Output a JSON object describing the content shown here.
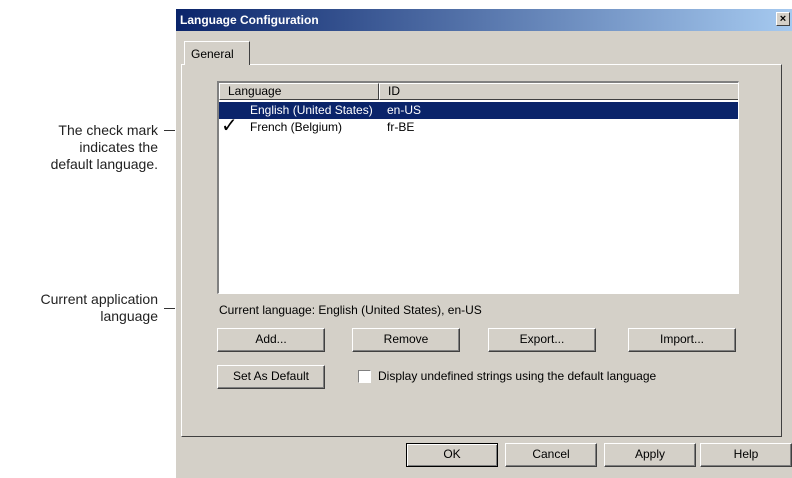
{
  "annotations": {
    "check_mark_note": [
      "The check mark",
      "indicates the",
      "default language."
    ],
    "current_lang_note": [
      "Current application",
      "language"
    ]
  },
  "dialog": {
    "title": "Language Configuration",
    "close_label": "×",
    "tab_label": "General",
    "list": {
      "columns": [
        "Language",
        "ID"
      ],
      "rows": [
        {
          "language": "English (United States)",
          "id": "en-US",
          "selected": true,
          "default": false
        },
        {
          "language": "French (Belgium)",
          "id": "fr-BE",
          "selected": false,
          "default": true
        }
      ],
      "check_glyph": "✓"
    },
    "current_language": "Current language: English (United States), en-US",
    "buttons": {
      "add": "Add...",
      "remove": "Remove",
      "export": "Export...",
      "import": "Import...",
      "set_default": "Set As Default"
    },
    "checkbox": {
      "label": "Display undefined strings using the default language",
      "checked": false
    },
    "footer": {
      "ok": "OK",
      "cancel": "Cancel",
      "apply": "Apply",
      "help": "Help"
    }
  }
}
